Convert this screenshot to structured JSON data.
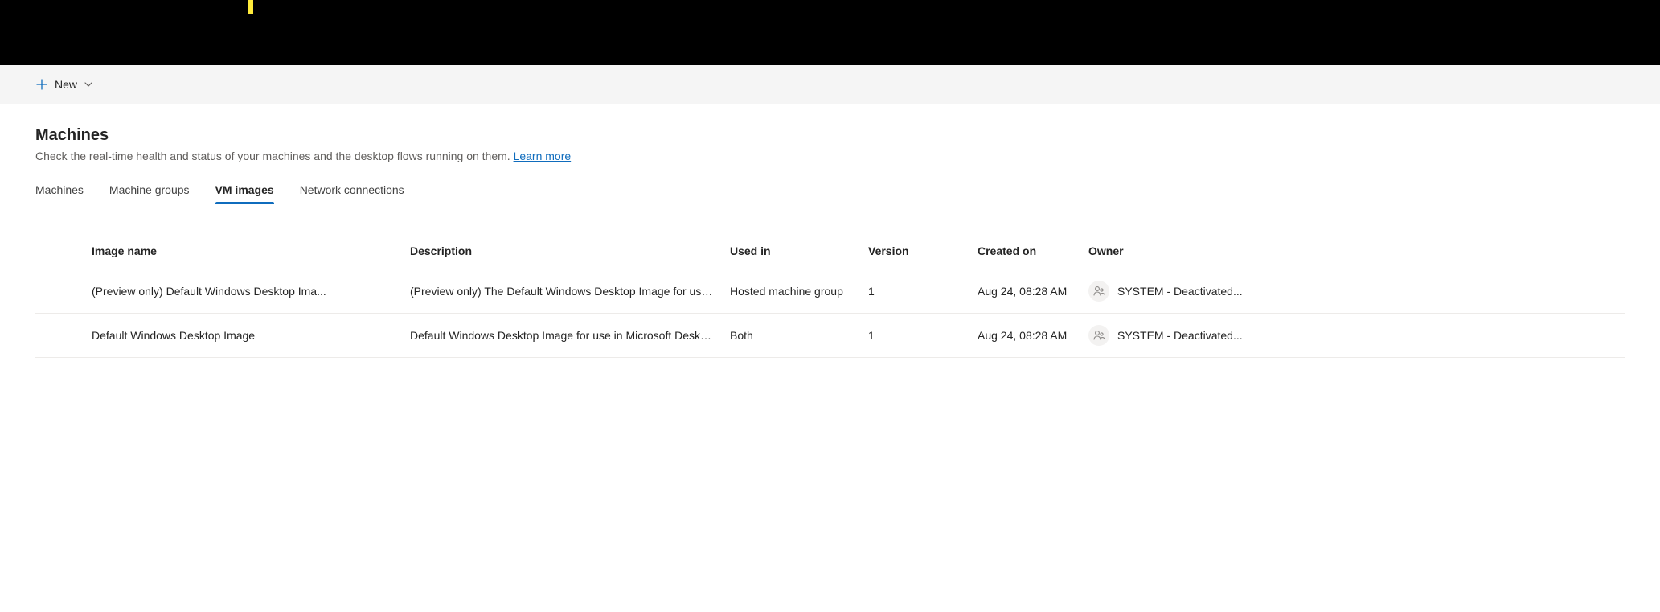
{
  "commandbar": {
    "new_label": "New"
  },
  "header": {
    "title": "Machines",
    "description_pre": "Check the real-time health and status of your machines and the desktop flows running on them. ",
    "learn_more_label": "Learn more"
  },
  "tabs": [
    {
      "label": "Machines",
      "selected": false
    },
    {
      "label": "Machine groups",
      "selected": false
    },
    {
      "label": "VM images",
      "selected": true
    },
    {
      "label": "Network connections",
      "selected": false
    }
  ],
  "table": {
    "columns": {
      "image_name": "Image name",
      "description": "Description",
      "used_in": "Used in",
      "version": "Version",
      "created_on": "Created on",
      "owner": "Owner"
    },
    "rows": [
      {
        "image_name": "(Preview only) Default Windows Desktop Ima...",
        "description": "(Preview only) The Default Windows Desktop Image for use i...",
        "used_in": "Hosted machine group",
        "version": "1",
        "created_on": "Aug 24, 08:28 AM",
        "owner": "SYSTEM - Deactivated..."
      },
      {
        "image_name": "Default Windows Desktop Image",
        "description": "Default Windows Desktop Image for use in Microsoft Deskto...",
        "used_in": "Both",
        "version": "1",
        "created_on": "Aug 24, 08:28 AM",
        "owner": "SYSTEM - Deactivated..."
      }
    ]
  }
}
